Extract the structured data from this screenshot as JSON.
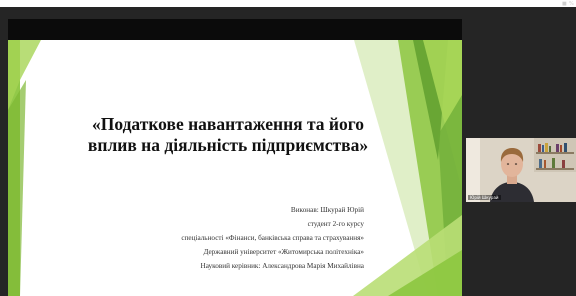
{
  "status": {
    "indicator": "■ %"
  },
  "presentation": {
    "title_line1": "«Податкове навантаження та його",
    "title_line2": "вплив на діяльність підприємства»",
    "info_lines": [
      "Виконав: Шкурай Юрій",
      "студент 2-го курсу",
      "спеціальності «Фінанси, банківська справа та страхування»",
      "Державний університет «Житомирська політехніка»",
      "Науковий керівник: Александрова Марія Михайлівна"
    ]
  },
  "participant": {
    "name": "Юрій Шкурай"
  },
  "colors": {
    "accent_green": "#8cc63f",
    "dark_green": "#5a9a2a",
    "background": "#252525"
  }
}
